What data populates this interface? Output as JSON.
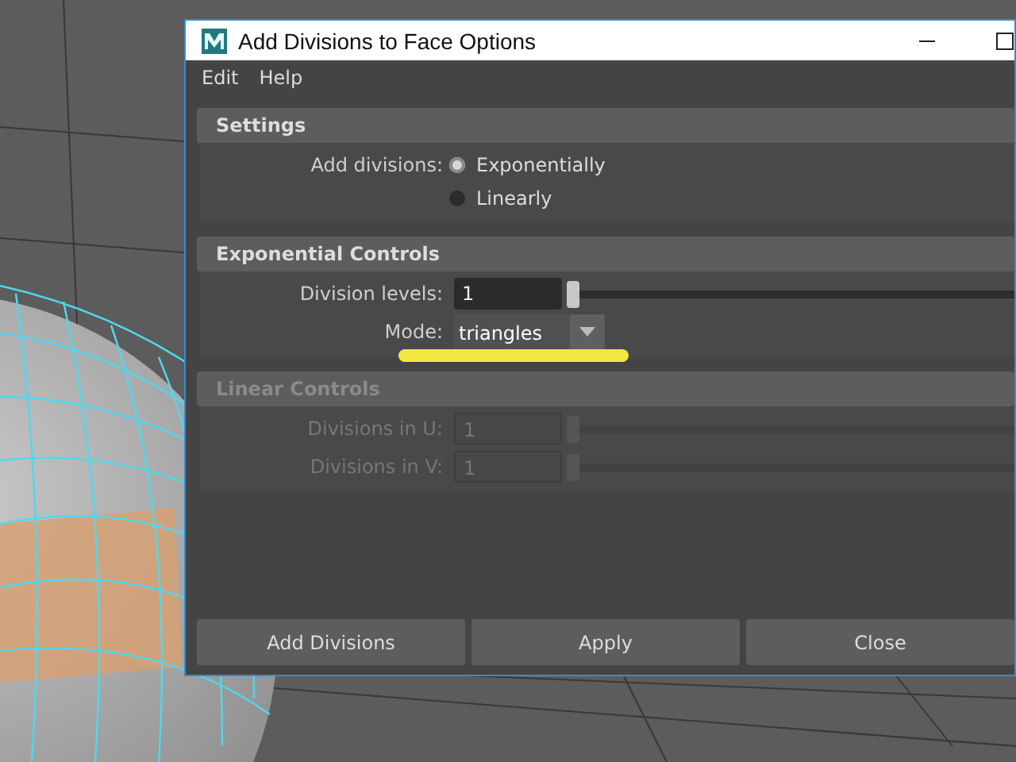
{
  "window": {
    "title": "Add Divisions to Face Options"
  },
  "menu": [
    "Edit",
    "Help"
  ],
  "sections": [
    {
      "title": "Settings",
      "disabled": false,
      "rows": [
        {
          "kind": "radio",
          "label": "Add divisions:",
          "options": [
            {
              "label": "Exponentially",
              "selected": true
            },
            {
              "label": "Linearly",
              "selected": false
            }
          ]
        }
      ]
    },
    {
      "title": "Exponential Controls",
      "disabled": false,
      "rows": [
        {
          "kind": "slider",
          "label": "Division levels:",
          "value": "1",
          "level": 0
        },
        {
          "kind": "dropdown",
          "label": "Mode:",
          "value": "triangles",
          "highlighted": true
        }
      ]
    },
    {
      "title": "Linear Controls",
      "disabled": true,
      "rows": [
        {
          "kind": "slider",
          "label": "Divisions in U:",
          "value": "1",
          "level": 0
        },
        {
          "kind": "slider",
          "label": "Divisions in V:",
          "value": "1",
          "level": 0
        }
      ]
    }
  ],
  "buttons": [
    "Add Divisions",
    "Apply",
    "Close"
  ]
}
